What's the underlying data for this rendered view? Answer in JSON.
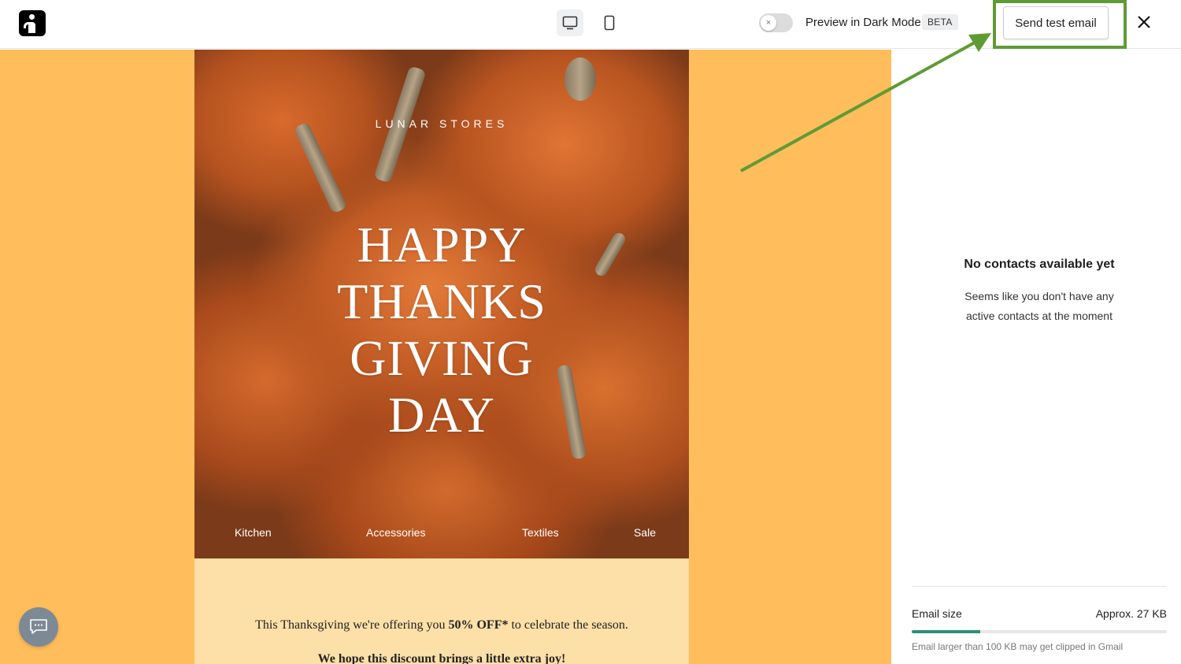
{
  "header": {
    "logo_icon": "brevo-logo-icon",
    "device_toggle": {
      "desktop_icon": "desktop-icon",
      "mobile_icon": "mobile-icon",
      "selected": "desktop"
    },
    "dark_mode": {
      "label": "Preview in Dark Mode",
      "badge": "BETA",
      "enabled": false,
      "toggle_glyph": "×"
    },
    "send_test_label": "Send test email",
    "close_icon": "close-icon",
    "highlight_color": "#5f9b35"
  },
  "email": {
    "background_color": "#ffbd5c",
    "brand": "LUNAR STORES",
    "title_lines": [
      "HAPPY",
      "THANKS",
      "GIVING",
      "DAY"
    ],
    "nav": [
      "Kitchen",
      "Accessories",
      "Textiles",
      "Sale"
    ],
    "offer": {
      "before": "This Thanksgiving we're offering you ",
      "highlight": "50% OFF*",
      "after": " to celebrate the season."
    },
    "hope": "We hope this discount brings a little extra joy!"
  },
  "chat": {
    "icon": "chat-icon"
  },
  "panel": {
    "empty_title": "No contacts available yet",
    "empty_desc": "Seems like you don't have any active contacts at the moment",
    "email_size_label": "Email size",
    "email_size_value": "Approx. 27 KB",
    "email_size_fraction": 0.27,
    "email_size_note": "Email larger than 100 KB may get clipped in Gmail",
    "bar_color": "#2f8f7a"
  }
}
